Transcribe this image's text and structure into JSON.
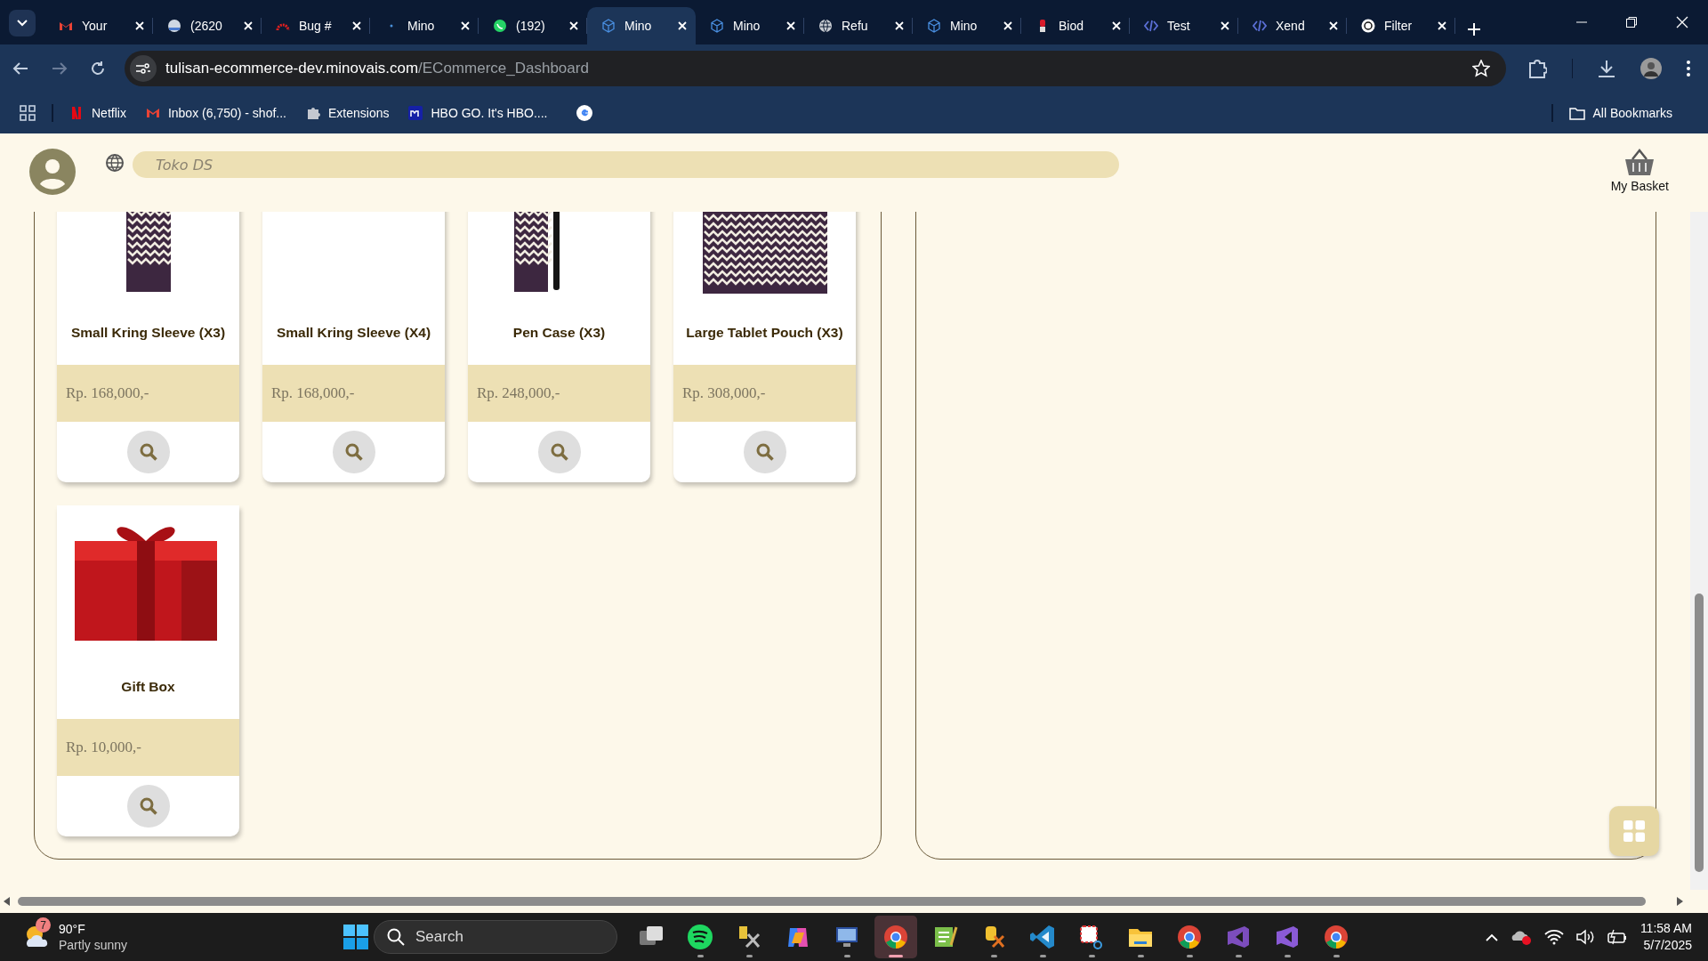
{
  "browser": {
    "tabs": [
      {
        "title": "Your",
        "selected": false
      },
      {
        "title": "(2620",
        "selected": false
      },
      {
        "title": "Bug #",
        "selected": false
      },
      {
        "title": "Mino",
        "selected": false
      },
      {
        "title": "(192)",
        "selected": false
      },
      {
        "title": "Mino",
        "selected": true
      },
      {
        "title": "Mino",
        "selected": false
      },
      {
        "title": "Refu",
        "selected": false
      },
      {
        "title": "Mino",
        "selected": false
      },
      {
        "title": "Biod",
        "selected": false
      },
      {
        "title": "Test",
        "selected": false
      },
      {
        "title": "Xend",
        "selected": false
      },
      {
        "title": "Filter",
        "selected": false
      }
    ],
    "address": {
      "host": "tulisan-ecommerce-dev.minovais.com",
      "path": "/ECommerce_Dashboard"
    },
    "bookmarks": [
      {
        "label": "Netflix"
      },
      {
        "label": "Inbox (6,750) - shof..."
      },
      {
        "label": "Extensions"
      },
      {
        "label": "HBO GO. It's HBO...."
      }
    ],
    "all_bookmarks": "All Bookmarks"
  },
  "header": {
    "search": {
      "placeholder": "Toko DS"
    },
    "basket_label": "My Basket"
  },
  "products": [
    {
      "name": "Small Kring Sleeve (X3)",
      "price": "Rp. 168,000,-"
    },
    {
      "name": "Small Kring Sleeve (X4)",
      "price": "Rp. 168,000,-"
    },
    {
      "name": "Pen Case (X3)",
      "price": "Rp. 248,000,-"
    },
    {
      "name": "Large Tablet Pouch (X3)",
      "price": "Rp. 308,000,-"
    },
    {
      "name": "Gift Box",
      "price": "Rp. 10,000,-"
    }
  ],
  "taskbar": {
    "weather": {
      "badge": "7",
      "temperature": "90°F",
      "condition": "Partly sunny"
    },
    "search": {
      "placeholder": "Search"
    },
    "apps": [
      {
        "running": false,
        "selected": false
      },
      {
        "running": true,
        "selected": false
      },
      {
        "running": true,
        "selected": false
      },
      {
        "running": false,
        "selected": false
      },
      {
        "running": true,
        "selected": false
      },
      {
        "running": true,
        "selected": true
      },
      {
        "running": false,
        "selected": false
      },
      {
        "running": true,
        "selected": false
      },
      {
        "running": true,
        "selected": false
      },
      {
        "running": true,
        "selected": false
      },
      {
        "running": true,
        "selected": false
      },
      {
        "running": true,
        "selected": false
      },
      {
        "running": true,
        "selected": false
      },
      {
        "running": true,
        "selected": false
      },
      {
        "running": true,
        "selected": false
      }
    ],
    "time": "11:58 AM",
    "date": "5/7/2025"
  }
}
